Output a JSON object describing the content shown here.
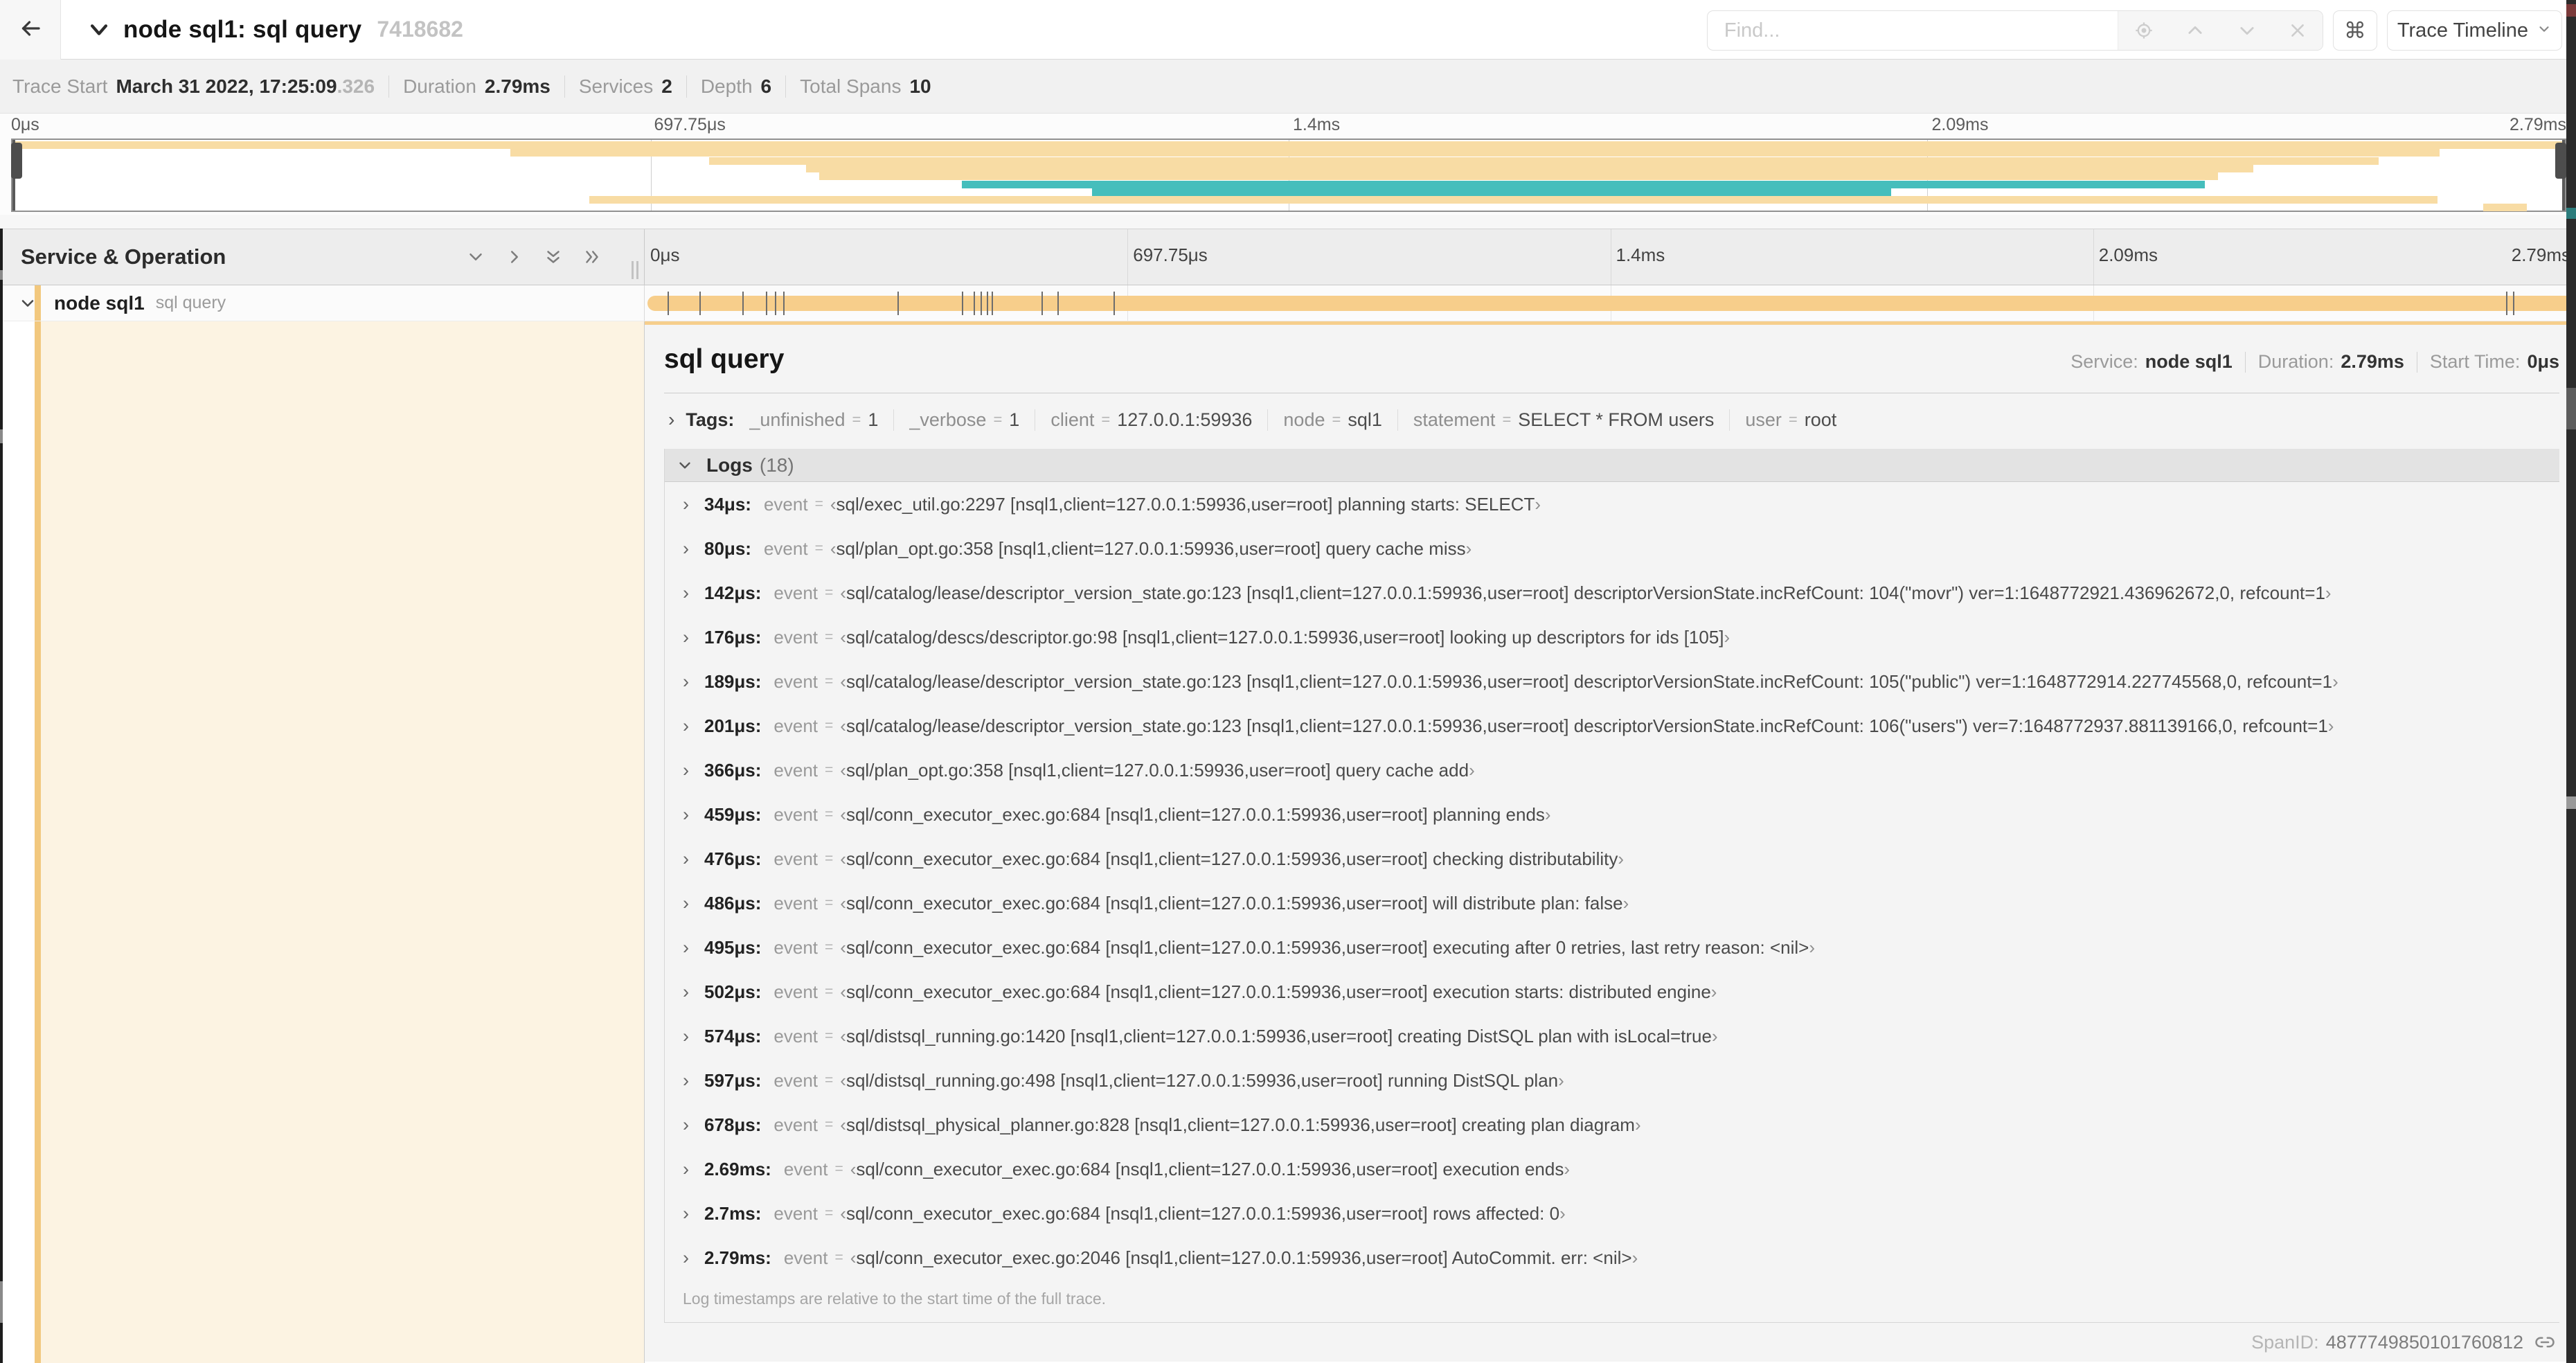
{
  "colors": {
    "tan": "#F8DCA4",
    "span_tan": "#F7CE8B",
    "teal": "#45BEBC",
    "service_bar": "#F2C87E",
    "cream": "#FCF3E2"
  },
  "header": {
    "title": "node sql1: sql query",
    "trace_id": "7418682",
    "find_placeholder": "Find...",
    "kbd_shortcut": "⌘",
    "view_selector": "Trace Timeline"
  },
  "summary": {
    "items": [
      {
        "label": "Trace Start",
        "value": "March 31 2022, 17:25:09",
        "suffix": ".326"
      },
      {
        "label": "Duration",
        "value": "2.79ms"
      },
      {
        "label": "Services",
        "value": "2"
      },
      {
        "label": "Depth",
        "value": "6"
      },
      {
        "label": "Total Spans",
        "value": "10"
      }
    ]
  },
  "minimap": {
    "ticks": [
      "0μs",
      "697.75μs",
      "1.4ms",
      "2.09ms",
      "2.79ms"
    ],
    "tick_pos": [
      0,
      25,
      50,
      75,
      100
    ],
    "spans": [
      {
        "row": 0,
        "start": 0,
        "end": 1,
        "color": "tan"
      },
      {
        "row": 1,
        "start": 0.195,
        "end": 0.951,
        "color": "tan"
      },
      {
        "row": 2,
        "start": 0.273,
        "end": 0.927,
        "color": "tan"
      },
      {
        "row": 3,
        "start": 0.311,
        "end": 0.878,
        "color": "tan"
      },
      {
        "row": 4,
        "start": 0.316,
        "end": 0.864,
        "color": "tan"
      },
      {
        "row": 5,
        "start": 0.372,
        "end": 0.859,
        "color": "teal"
      },
      {
        "row": 6,
        "start": 0.423,
        "end": 0.736,
        "color": "teal"
      },
      {
        "row": 7,
        "start": 0.226,
        "end": 0.95,
        "color": "tan"
      },
      {
        "row": 8,
        "start": 0.968,
        "end": 0.985,
        "color": "tan"
      }
    ]
  },
  "timeline": {
    "header_left": "Service & Operation",
    "ticks": [
      "0μs",
      "697.75μs",
      "1.4ms",
      "2.09ms",
      "2.79ms"
    ],
    "tick_pos": [
      0,
      25,
      50,
      75,
      100
    ],
    "total_us": 2790
  },
  "span_row": {
    "service": "node sql1",
    "operation": "sql query"
  },
  "detail": {
    "title": "sql query",
    "meta": {
      "service_label": "Service:",
      "service_value": "node sql1",
      "duration_label": "Duration:",
      "duration_value": "2.79ms",
      "start_label": "Start Time:",
      "start_value": "0μs"
    },
    "tags_label": "Tags:",
    "tags": [
      {
        "key": "_unfinished",
        "value": "1"
      },
      {
        "key": "_verbose",
        "value": "1"
      },
      {
        "key": "client",
        "value": "127.0.0.1:59936"
      },
      {
        "key": "node",
        "value": "sql1"
      },
      {
        "key": "statement",
        "value": "SELECT * FROM users"
      },
      {
        "key": "user",
        "value": "root"
      }
    ],
    "logs_label": "Logs",
    "logs_count": "(18)",
    "logs_field": "event",
    "logs": [
      {
        "t": "34μs:",
        "us": 34,
        "value": "sql/exec_util.go:2297 [nsql1,client=127.0.0.1:59936,user=root] planning starts: SELECT"
      },
      {
        "t": "80μs:",
        "us": 80,
        "value": "sql/plan_opt.go:358 [nsql1,client=127.0.0.1:59936,user=root] query cache miss"
      },
      {
        "t": "142μs:",
        "us": 142,
        "value": "sql/catalog/lease/descriptor_version_state.go:123 [nsql1,client=127.0.0.1:59936,user=root] descriptorVersionState.incRefCount: 104(\"movr\") ver=1:1648772921.436962672,0, refcount=1"
      },
      {
        "t": "176μs:",
        "us": 176,
        "value": "sql/catalog/descs/descriptor.go:98 [nsql1,client=127.0.0.1:59936,user=root] looking up descriptors for ids [105]"
      },
      {
        "t": "189μs:",
        "us": 189,
        "value": "sql/catalog/lease/descriptor_version_state.go:123 [nsql1,client=127.0.0.1:59936,user=root] descriptorVersionState.incRefCount: 105(\"public\") ver=1:1648772914.227745568,0, refcount=1"
      },
      {
        "t": "201μs:",
        "us": 201,
        "value": "sql/catalog/lease/descriptor_version_state.go:123 [nsql1,client=127.0.0.1:59936,user=root] descriptorVersionState.incRefCount: 106(\"users\") ver=7:1648772937.881139166,0, refcount=1"
      },
      {
        "t": "366μs:",
        "us": 366,
        "value": "sql/plan_opt.go:358 [nsql1,client=127.0.0.1:59936,user=root] query cache add"
      },
      {
        "t": "459μs:",
        "us": 459,
        "value": "sql/conn_executor_exec.go:684 [nsql1,client=127.0.0.1:59936,user=root] planning ends"
      },
      {
        "t": "476μs:",
        "us": 476,
        "value": "sql/conn_executor_exec.go:684 [nsql1,client=127.0.0.1:59936,user=root] checking distributability"
      },
      {
        "t": "486μs:",
        "us": 486,
        "value": "sql/conn_executor_exec.go:684 [nsql1,client=127.0.0.1:59936,user=root] will distribute plan: false"
      },
      {
        "t": "495μs:",
        "us": 495,
        "value": "sql/conn_executor_exec.go:684 [nsql1,client=127.0.0.1:59936,user=root] executing after 0 retries, last retry reason: <nil>"
      },
      {
        "t": "502μs:",
        "us": 502,
        "value": "sql/conn_executor_exec.go:684 [nsql1,client=127.0.0.1:59936,user=root] execution starts: distributed engine"
      },
      {
        "t": "574μs:",
        "us": 574,
        "value": "sql/distsql_running.go:1420 [nsql1,client=127.0.0.1:59936,user=root] creating DistSQL plan with isLocal=true"
      },
      {
        "t": "597μs:",
        "us": 597,
        "value": "sql/distsql_running.go:498 [nsql1,client=127.0.0.1:59936,user=root] running DistSQL plan"
      },
      {
        "t": "678μs:",
        "us": 678,
        "value": "sql/distsql_physical_planner.go:828 [nsql1,client=127.0.0.1:59936,user=root] creating plan diagram"
      },
      {
        "t": "2.69ms:",
        "us": 2690,
        "value": "sql/conn_executor_exec.go:684 [nsql1,client=127.0.0.1:59936,user=root] execution ends"
      },
      {
        "t": "2.7ms:",
        "us": 2700,
        "value": "sql/conn_executor_exec.go:684 [nsql1,client=127.0.0.1:59936,user=root] rows affected: 0"
      },
      {
        "t": "2.79ms:",
        "us": 2790,
        "value": "sql/conn_executor_exec.go:2046 [nsql1,client=127.0.0.1:59936,user=root] AutoCommit. err: <nil>"
      }
    ],
    "footer_note": "Log timestamps are relative to the start time of the full trace.",
    "span_id_label": "SpanID:",
    "span_id_value": "4877749850101760812"
  }
}
